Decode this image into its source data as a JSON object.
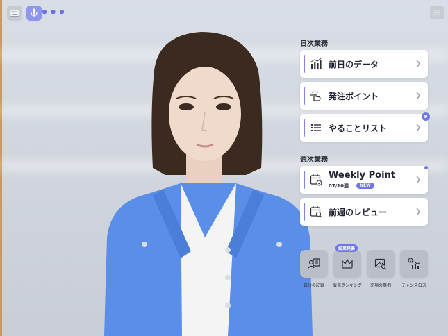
{
  "toolbar": {
    "keyboard_icon": "keyboard-icon",
    "mic_icon": "microphone-icon",
    "more_label": "•••",
    "menu_icon": "menu-icon"
  },
  "daily": {
    "title": "日次業務",
    "items": [
      {
        "label": "前日のデータ",
        "icon": "bar-chart-icon"
      },
      {
        "label": "発注ポイント",
        "icon": "hand-point-icon"
      },
      {
        "label": "やることリスト",
        "icon": "list-icon",
        "badge": "9"
      }
    ]
  },
  "weekly": {
    "title": "週次業務",
    "items": [
      {
        "label": "Weekly Point",
        "sub": "07/10週",
        "tag": "NEW",
        "icon": "calendar-check-icon"
      },
      {
        "label": "前週のレビュー",
        "icon": "calendar-search-icon"
      }
    ]
  },
  "shortcuts": {
    "tag": "結果発表",
    "items": [
      {
        "label": "自分の記録",
        "icon": "profile-card-icon"
      },
      {
        "label": "販売ランキング",
        "icon": "crown-icon"
      },
      {
        "label": "売場の事例",
        "icon": "image-search-icon"
      },
      {
        "label": "チャンスロス",
        "icon": "chart-down-icon"
      }
    ]
  },
  "colors": {
    "accent": "#6f77e8",
    "card": "#ffffff",
    "tile": "#b9bec7"
  }
}
